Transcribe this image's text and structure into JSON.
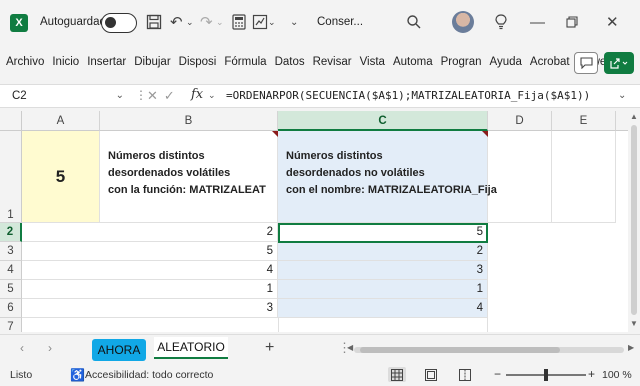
{
  "titlebar": {
    "autosave_label": "Autoguardado",
    "filename": "Conser...",
    "dropdown_glyph": "⌄"
  },
  "ribbon": {
    "tabs": [
      "Archivo",
      "Inicio",
      "Insertar",
      "Dibujar",
      "Disposi",
      "Fórmula",
      "Datos",
      "Revisar",
      "Vista",
      "Automa",
      "Progran",
      "Ayuda",
      "Acrobat",
      "Power P"
    ]
  },
  "formula_bar": {
    "name_box": "C2",
    "fx": "fx",
    "formula": "=ORDENARPOR(SECUENCIA($A$1);MATRIZALEATORIA_Fija($A$1))"
  },
  "columns": [
    "A",
    "B",
    "C",
    "D",
    "E"
  ],
  "rows": [
    "1",
    "2",
    "3",
    "4",
    "5",
    "6",
    "7"
  ],
  "sheet": {
    "a1": "5",
    "b1": [
      "Números distintos",
      "desordenados volátiles",
      "con la función: MATRIZALEAT"
    ],
    "c1": [
      "Números distintos",
      "desordenados no volátiles",
      "con el nombre: MATRIZALEATORIA_Fija"
    ],
    "b_values": [
      "2",
      "5",
      "4",
      "1",
      "3"
    ],
    "c_values": [
      "5",
      "2",
      "3",
      "1",
      "4"
    ]
  },
  "sheet_tabs": [
    "AHORA",
    "ALEATORIO"
  ],
  "status": {
    "ready": "Listo",
    "accessibility": "Accesibilidad: todo correcto",
    "zoom": "100 %"
  },
  "colors": {
    "accent": "#107c41",
    "tab_ahora": "#11a8e6",
    "a1_fill": "#fffbd0",
    "c_fill": "#e3edf8"
  }
}
